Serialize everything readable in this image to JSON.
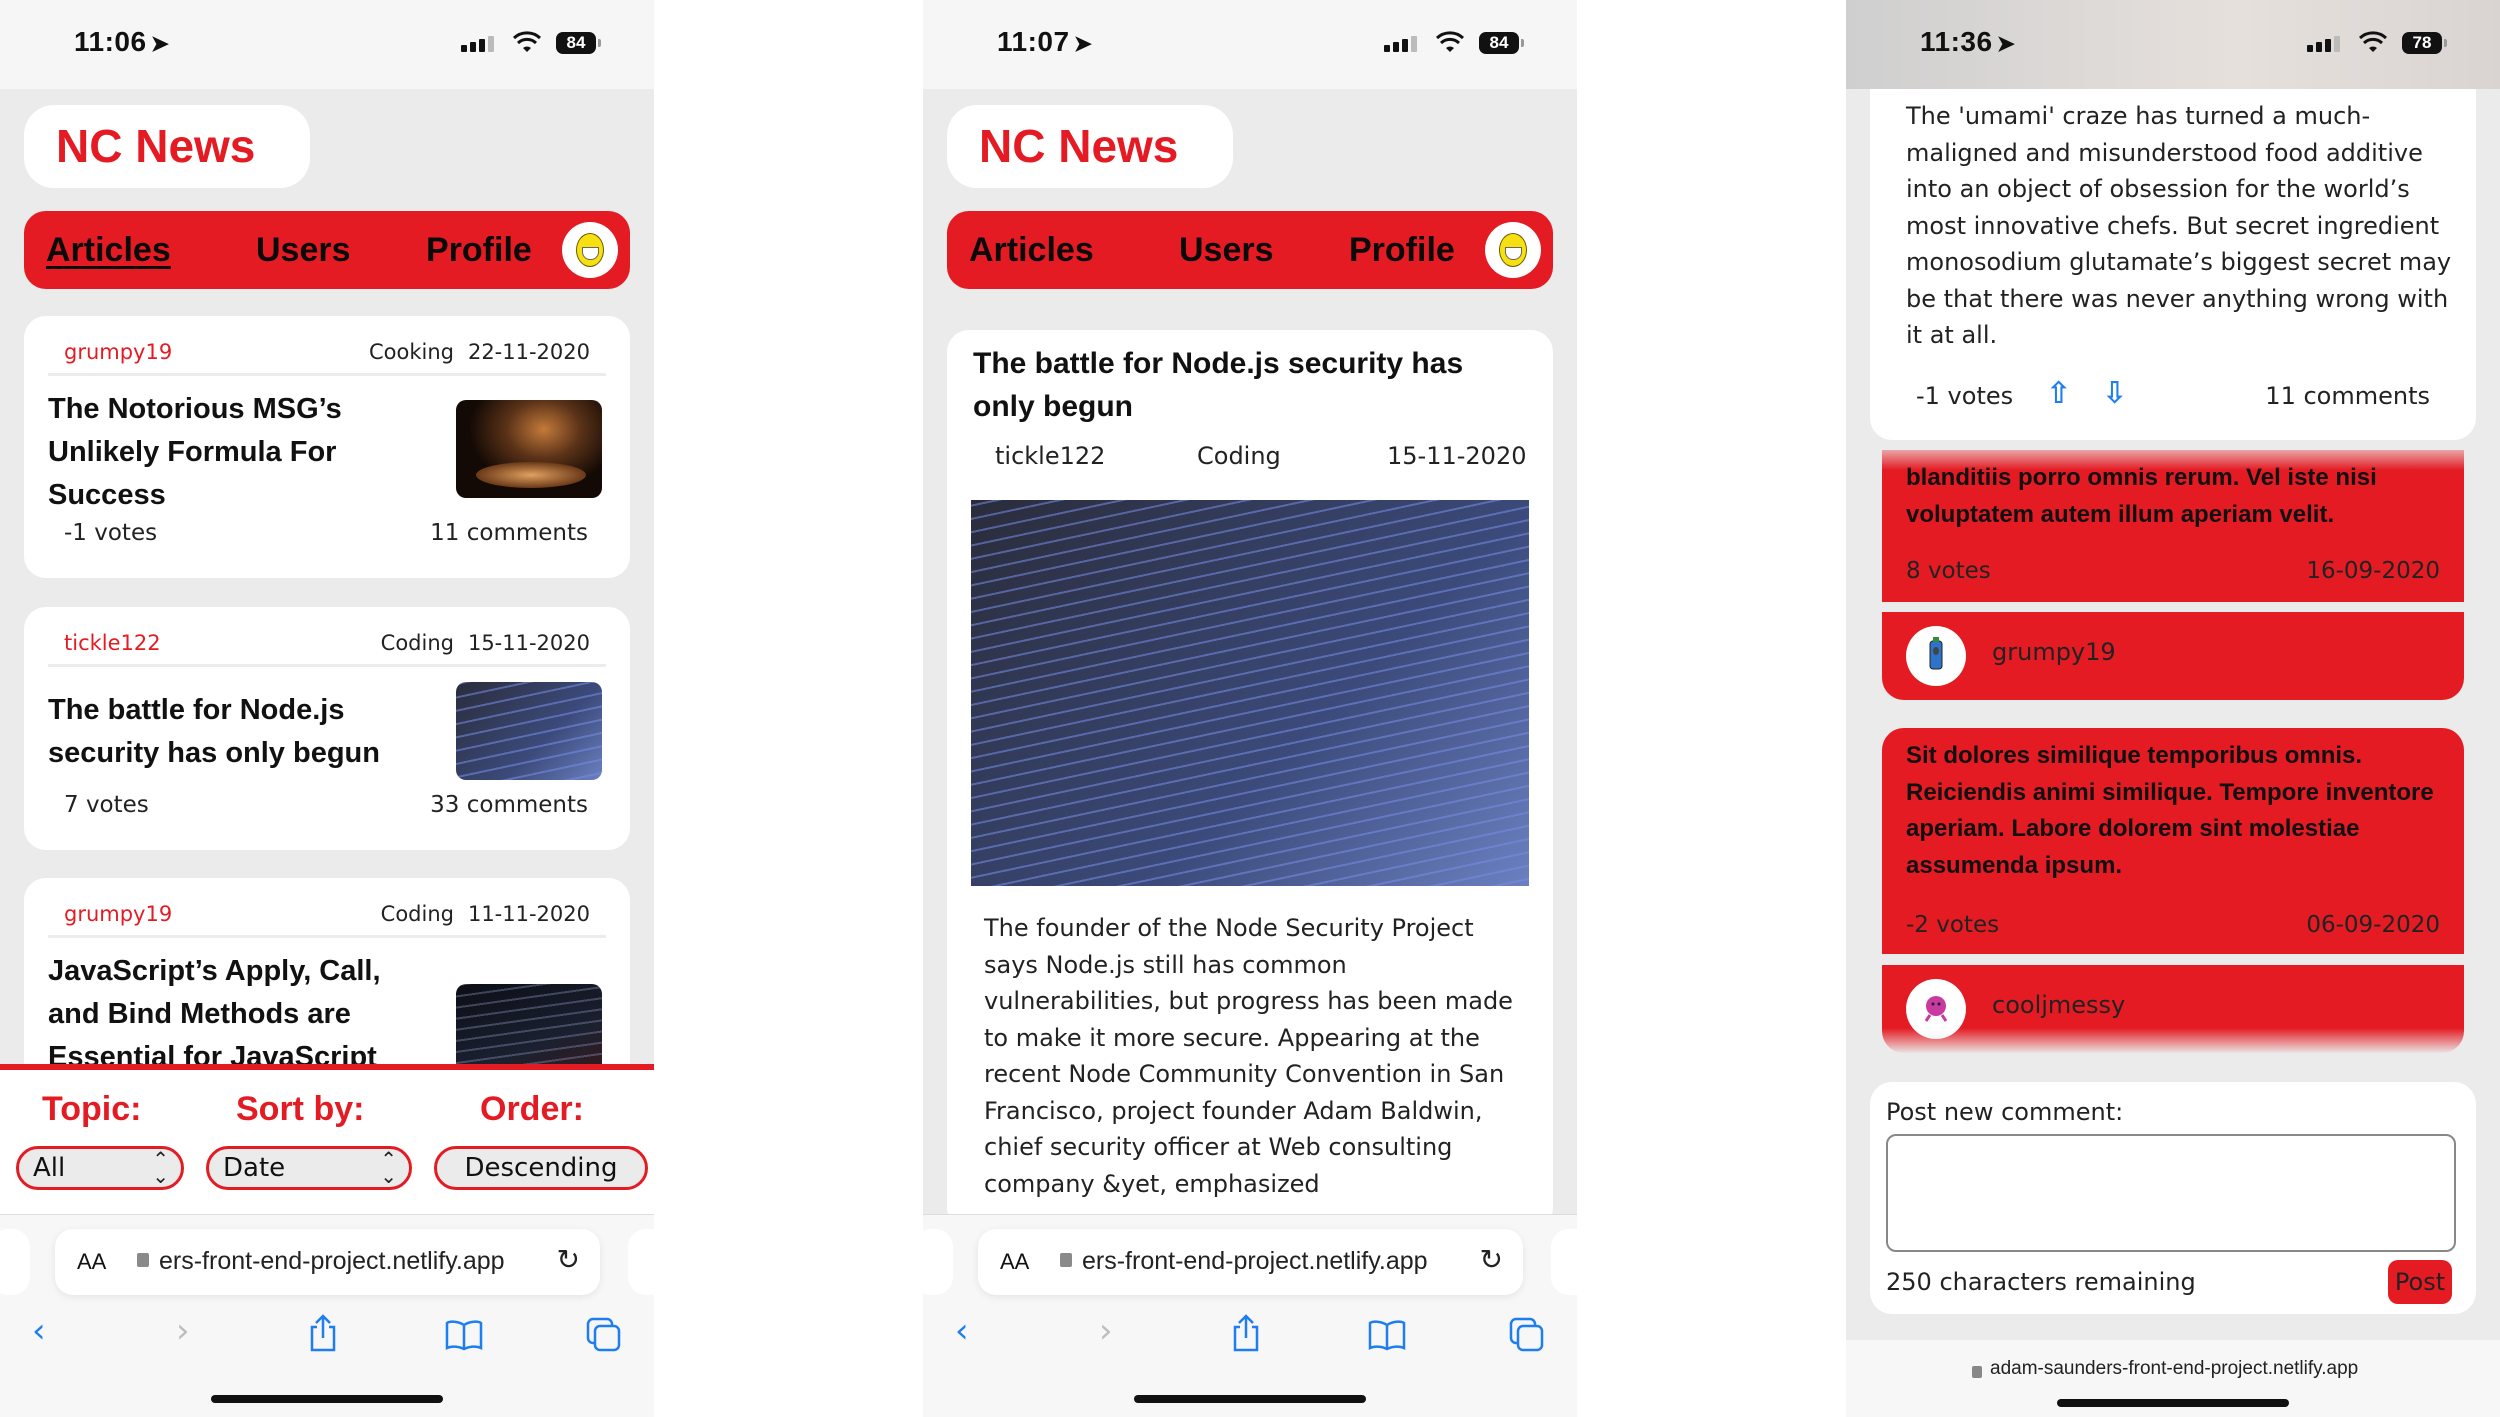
{
  "screens": [
    {
      "status": {
        "time": "11:06",
        "battery": "84"
      },
      "brand": "NC News",
      "nav": {
        "items": [
          "Articles",
          "Users",
          "Profile"
        ],
        "active": "Articles"
      },
      "articles": [
        {
          "author": "grumpy19",
          "topic": "Cooking",
          "date": "22-11-2020",
          "title": "The Notorious MSG’s Unlikely Formula For Success",
          "votes": "-1 votes",
          "comments": "11 comments",
          "image": "food-photo"
        },
        {
          "author": "tickle122",
          "topic": "Coding",
          "date": "15-11-2020",
          "title": "The battle for Node.js security has only begun",
          "votes": "7 votes",
          "comments": "33 comments",
          "image": "code-screen-photo"
        },
        {
          "author": "grumpy19",
          "topic": "Coding",
          "date": "11-11-2020",
          "title": "JavaScript’s Apply, Call, and Bind Methods are Essential for JavaScript",
          "image": "dark-code-photo"
        }
      ],
      "filters": {
        "topic_label": "Topic:",
        "topic_value": "All",
        "sort_label": "Sort by:",
        "sort_value": "Date",
        "order_label": "Order:",
        "order_value": "Descending"
      },
      "browser": {
        "text_size": "AA",
        "url": "ers-front-end-project.netlify.app"
      }
    },
    {
      "status": {
        "time": "11:07",
        "battery": "84"
      },
      "brand": "NC News",
      "nav": {
        "items": [
          "Articles",
          "Users",
          "Profile"
        ]
      },
      "article": {
        "title": "The battle for Node.js security has only begun",
        "author": "tickle122",
        "topic": "Coding",
        "date": "15-11-2020",
        "body": "The founder of the Node Security Project says Node.js still has common vulnerabilities, but progress has been made to make it more secure. Appearing at the recent Node Community Convention in San Francisco, project founder Adam Baldwin, chief security officer at Web consulting company &yet, emphasized"
      },
      "browser": {
        "text_size": "AA",
        "url": "ers-front-end-project.netlify.app"
      }
    },
    {
      "status": {
        "time": "11:36",
        "battery": "78"
      },
      "article": {
        "body": "The 'umami' craze has turned a much-maligned and misunderstood food additive into an object of obsession for the world’s most innovative chefs. But secret ingredient monosodium glutamate’s biggest secret may be that there was never anything wrong with it at all.",
        "votes": "-1 votes",
        "comments": "11 comments"
      },
      "comments": [
        {
          "text": "blanditiis porro omnis rerum. Vel iste nisi voluptatem autem illum aperiam velit.",
          "votes": "8 votes",
          "date": "16-09-2020",
          "author": "grumpy19"
        },
        {
          "text": "Sit dolores similique temporibus omnis. Reiciendis animi similique. Tempore inventore aperiam. Labore dolorem sint molestiae assumenda ipsum.",
          "votes": "-2 votes",
          "date": "06-09-2020",
          "author": "cooljmessy"
        }
      ],
      "new_comment": {
        "label": "Post new comment:",
        "value": "",
        "remaining": "250 characters remaining",
        "post_label": "Post"
      },
      "browser": {
        "url": "adam-saunders-front-end-project.netlify.app"
      }
    }
  ],
  "colors": {
    "accent": "#e41b23",
    "link_blue": "#1e7ef0",
    "page_bg": "#ebebeb"
  }
}
